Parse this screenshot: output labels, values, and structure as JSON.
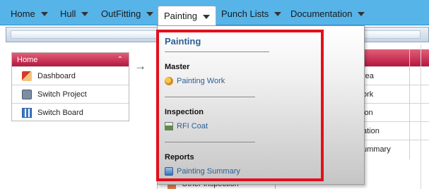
{
  "topnav": {
    "items": [
      {
        "label": "Home"
      },
      {
        "label": "Hull"
      },
      {
        "label": "OutFitting"
      },
      {
        "label": "Painting",
        "active": true
      },
      {
        "label": "Punch Lists"
      },
      {
        "label": "Documentation"
      }
    ]
  },
  "home_panel": {
    "title": "Home",
    "items": [
      {
        "label": "Dashboard",
        "icon": "dashboard-icon"
      },
      {
        "label": "Switch Project",
        "icon": "switch-project-icon"
      },
      {
        "label": "Switch Board",
        "icon": "switch-board-icon"
      }
    ]
  },
  "background_table": {
    "rows": [
      "rea",
      "ork",
      "ion",
      "ation",
      "ummary"
    ]
  },
  "background_bottom": {
    "label": "Other Inspection"
  },
  "dropdown": {
    "title": "Painting",
    "sections": [
      {
        "heading": "Master",
        "link": "Painting Work",
        "icon": "painting-work-icon"
      },
      {
        "heading": "Inspection",
        "link": "RFI Coat",
        "icon": "rfi-coat-icon"
      },
      {
        "heading": "Reports",
        "link": "Painting Summary",
        "icon": "painting-summary-icon"
      }
    ],
    "highlight_color": "#e2101b"
  },
  "colors": {
    "nav_bg": "#56b4e9",
    "panel_header": "#b5163f",
    "link": "#2a5f96"
  }
}
